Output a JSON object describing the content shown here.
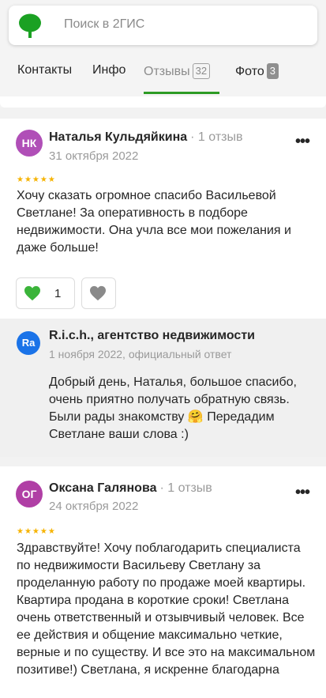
{
  "search": {
    "placeholder": "Поиск в 2ГИС"
  },
  "tabs": [
    {
      "label": "Контакты"
    },
    {
      "label": "Инфо"
    },
    {
      "label": "Отзывы",
      "count": "32"
    },
    {
      "label": "Фото",
      "count": "3"
    }
  ],
  "reviews": [
    {
      "initials": "НК",
      "author": "Наталья Кульдяйкина",
      "meta": "· 1 отзыв",
      "date": "31 октября 2022",
      "stars": "★★★★★",
      "text": "Хочу сказать огромное спасибо Васильевой Светлане! За оперативность в подборе недвижимости. Она учла все мои пожелания и даже больше!",
      "likes": "1",
      "more": "•••",
      "reply": {
        "initials": "Ra",
        "name": "R.i.c.h., агентство недвижимости",
        "date": "1 ноября 2022, официальный ответ",
        "text": "Добрый день, Наталья, большое спасибо, очень приятно получать обратную связь. Были рады знакомству 🤗 Передадим Светлане ваши слова :)"
      }
    },
    {
      "initials": "ОГ",
      "author": "Оксана Галянова",
      "meta": "· 1 отзыв",
      "date": "24 октября 2022",
      "stars": "★★★★★",
      "more": "•••",
      "text": "Здравствуйте! Хочу поблагодарить специалиста по недвижимости Васильеву Светлану за проделанную работу по продаже моей квартиры. Квартира продана в короткие сроки! Светлана очень ответственный и отзывчивый человек. Все ее действия и общение максимально четкие, верные и по существу. И все это на максимальном позитиве!) Светлана, я искренне благодарна"
    }
  ],
  "colors": {
    "accent": "#2d9b24",
    "star": "#f6b300",
    "avatar1": "#b04fb7",
    "avatar2": "#b03fa5",
    "reply_avatar": "#1a73e8"
  }
}
